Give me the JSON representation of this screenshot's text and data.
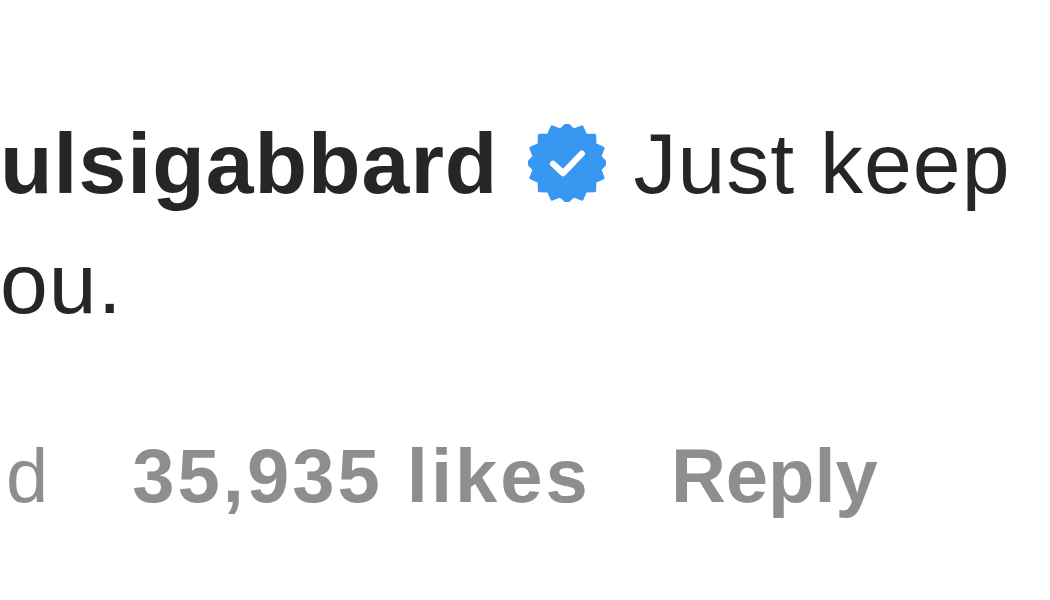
{
  "comment": {
    "username": "ulsigabbard",
    "verified": true,
    "text_lines": [
      "Just keep",
      "ou."
    ],
    "age": "d",
    "likes": "35,935 likes",
    "reply": "Reply"
  }
}
